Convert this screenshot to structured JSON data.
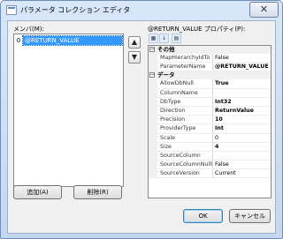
{
  "window": {
    "title": "パラメータ コレクション エディタ",
    "close_label": "✕"
  },
  "members": {
    "label": "メンバ(M):",
    "items": [
      {
        "index": "0",
        "label": "@RETURN_VALUE"
      }
    ],
    "move_up_label": "▲",
    "move_down_label": "▼",
    "add_label": "追加(A)",
    "remove_label": "削除(R)"
  },
  "properties": {
    "label": "@RETURN_VALUE プロパティ(P):",
    "toolbar": [
      "▦",
      "↓",
      "▤"
    ],
    "categories": [
      {
        "name": "その他",
        "toggle": "−",
        "rows": [
          {
            "name": "MapHierarchyIdTo",
            "value": "False",
            "bold": false
          },
          {
            "name": "ParameterName",
            "value": "@RETURN_VALUE",
            "bold": true
          }
        ]
      },
      {
        "name": "データ",
        "toggle": "−",
        "rows": [
          {
            "name": "AllowDbNull",
            "value": "True",
            "bold": true
          },
          {
            "name": "ColumnName",
            "value": "",
            "bold": false
          },
          {
            "name": "DbType",
            "value": "Int32",
            "bold": true
          },
          {
            "name": "Direction",
            "value": "ReturnValue",
            "bold": true
          },
          {
            "name": "Precision",
            "value": "10",
            "bold": true
          },
          {
            "name": "ProviderType",
            "value": "Int",
            "bold": true
          },
          {
            "name": "Scale",
            "value": "0",
            "bold": false
          },
          {
            "name": "Size",
            "value": "4",
            "bold": true
          },
          {
            "name": "SourceColumn",
            "value": "",
            "bold": false
          },
          {
            "name": "SourceColumnNullMapping",
            "value": "False",
            "bold": false
          },
          {
            "name": "SourceVersion",
            "value": "Current",
            "bold": false
          }
        ]
      }
    ]
  },
  "footer": {
    "ok_label": "OK",
    "cancel_label": "キャンセル"
  }
}
